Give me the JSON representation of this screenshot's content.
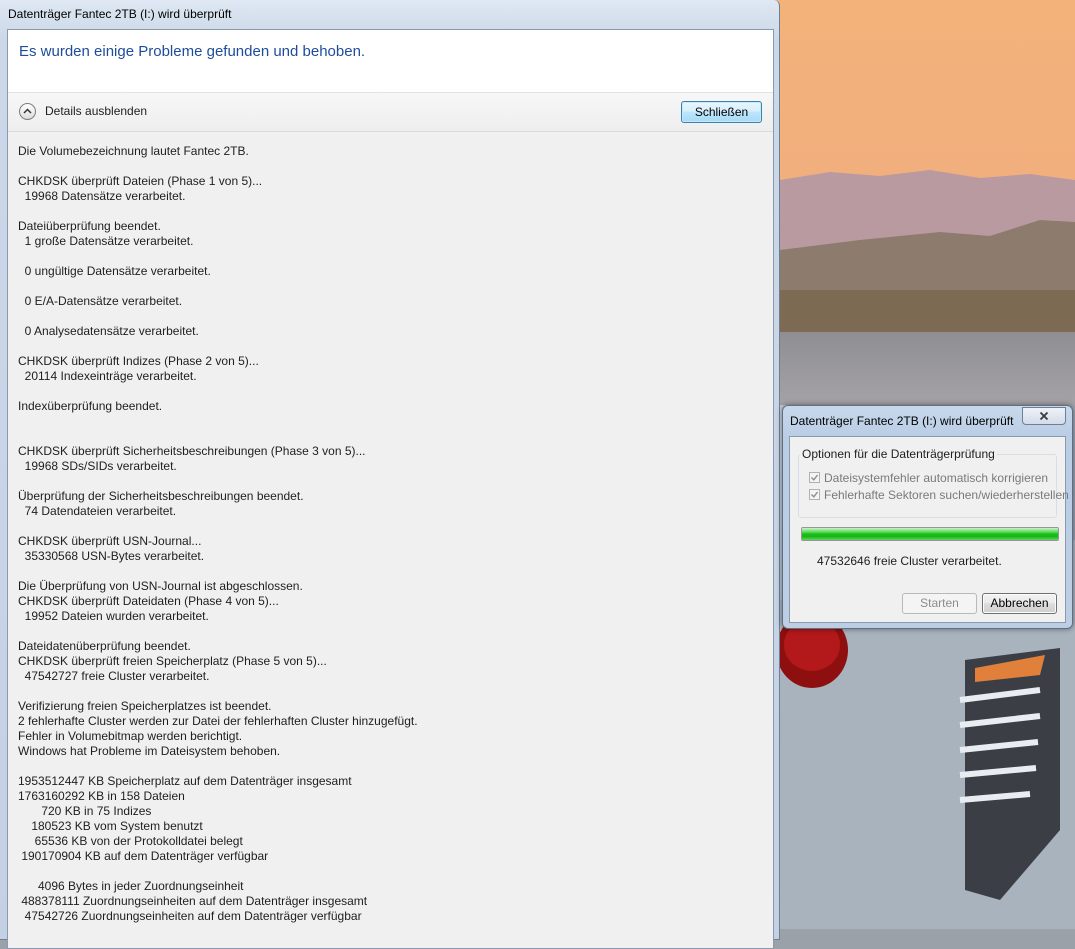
{
  "main_window": {
    "title": "Datenträger Fantec 2TB (I:) wird überprüft",
    "heading": "Es wurden einige Probleme gefunden und behoben.",
    "details_toggle_label": "Details ausblenden",
    "close_button_label": "Schließen",
    "log_text": "Die Volumebezeichnung lautet Fantec 2TB.\n\nCHKDSK überprüft Dateien (Phase 1 von 5)...\n  19968 Datensätze verarbeitet.\n\nDateiüberprüfung beendet.\n  1 große Datensätze verarbeitet.\n\n  0 ungültige Datensätze verarbeitet.\n\n  0 E/A-Datensätze verarbeitet.\n\n  0 Analysedatensätze verarbeitet.\n\nCHKDSK überprüft Indizes (Phase 2 von 5)...\n  20114 Indexeinträge verarbeitet.\n\nIndexüberprüfung beendet.\n\n\nCHKDSK überprüft Sicherheitsbeschreibungen (Phase 3 von 5)...\n  19968 SDs/SIDs verarbeitet.\n\nÜberprüfung der Sicherheitsbeschreibungen beendet.\n  74 Datendateien verarbeitet.\n\nCHKDSK überprüft USN-Journal...\n  35330568 USN-Bytes verarbeitet.\n\nDie Überprüfung von USN-Journal ist abgeschlossen.\nCHKDSK überprüft Dateidaten (Phase 4 von 5)...\n  19952 Dateien wurden verarbeitet.\n\nDateidatenüberprüfung beendet.\nCHKDSK überprüft freien Speicherplatz (Phase 5 von 5)...\n  47542727 freie Cluster verarbeitet.\n\nVerifizierung freien Speicherplatzes ist beendet.\n2 fehlerhafte Cluster werden zur Datei der fehlerhaften Cluster hinzugefügt.\nFehler in Volumebitmap werden berichtigt.\nWindows hat Probleme im Dateisystem behoben.\n\n1953512447 KB Speicherplatz auf dem Datenträger insgesamt\n1763160292 KB in 158 Dateien\n       720 KB in 75 Indizes\n    180523 KB vom System benutzt\n     65536 KB von der Protokolldatei belegt\n 190170904 KB auf dem Datenträger verfügbar\n\n      4096 Bytes in jeder Zuordnungseinheit\n 488378111 Zuordnungseinheiten auf dem Datenträger insgesamt\n  47542726 Zuordnungseinheiten auf dem Datenträger verfügbar"
  },
  "check_dialog": {
    "title": "Datenträger Fantec 2TB (I:) wird überprüft",
    "options_legend": "Optionen für die Datenträgerprüfung",
    "options": [
      {
        "label": "Dateisystemfehler automatisch korrigieren",
        "checked": true,
        "enabled": false
      },
      {
        "label": "Fehlerhafte Sektoren suchen/wiederherstellen",
        "checked": true,
        "enabled": false
      }
    ],
    "progress_fraction": 1.0,
    "progress_text": "47532646 freie Cluster verarbeitet.",
    "start_button_label": "Starten",
    "cancel_button_label": "Abbrechen"
  },
  "icons": [
    "chevron-up-icon",
    "close-icon",
    "checkmark-icon"
  ],
  "colors": {
    "heading_blue": "#1e4c9b",
    "progress_green": "#16c116",
    "log_background": "#f0f0f0"
  }
}
